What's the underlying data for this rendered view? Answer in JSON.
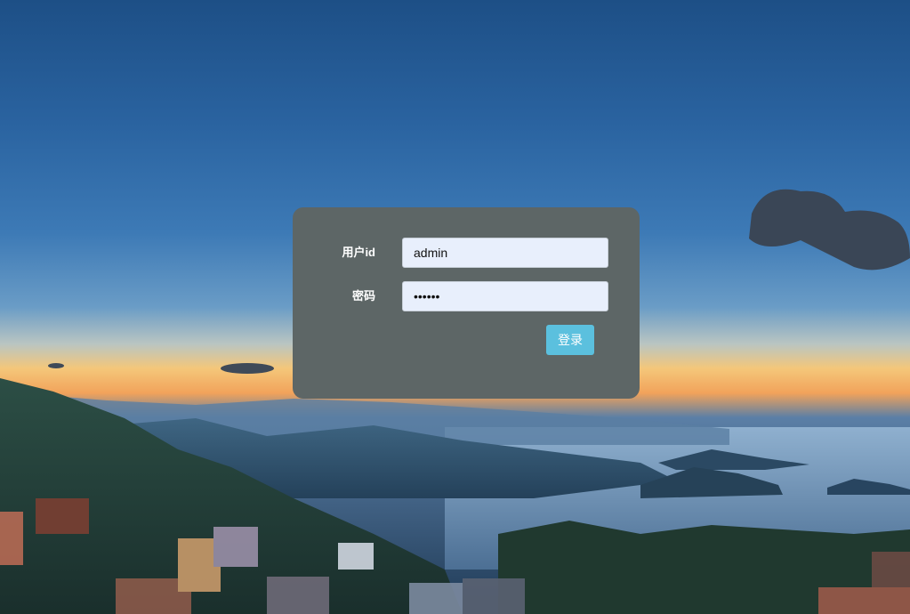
{
  "login": {
    "username_label": "用户id",
    "username_value": "admin",
    "password_label": "密码",
    "password_value": "••••••",
    "submit_label": "登录"
  },
  "colors": {
    "panel": "#5d6666",
    "button": "#5bc0de",
    "input_bg": "#e8effc"
  }
}
